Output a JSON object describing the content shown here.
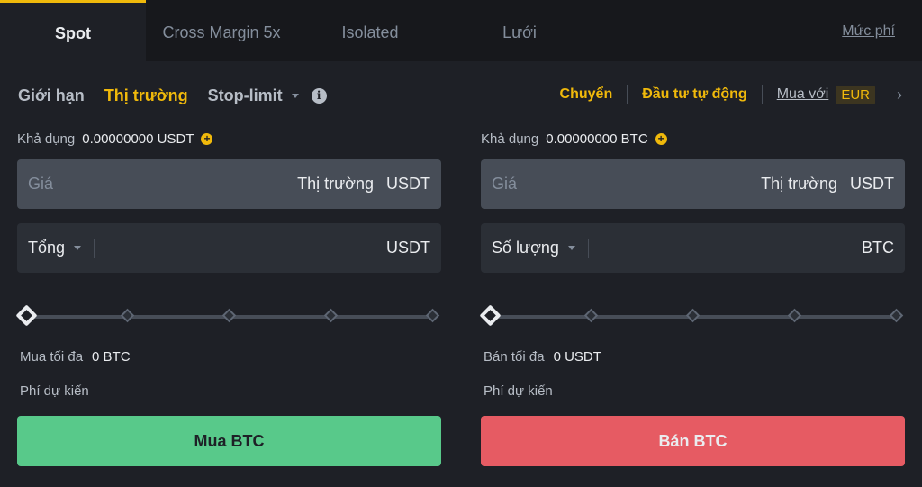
{
  "tabs": [
    {
      "label": "Spot"
    },
    {
      "label": "Cross Margin 5x"
    },
    {
      "label": "Isolated"
    },
    {
      "label": "Lưới"
    }
  ],
  "fee_link": "Mức phí",
  "order_types": {
    "limit": "Giới hạn",
    "market": "Thị trường",
    "stop_limit": "Stop-limit"
  },
  "right_links": {
    "transfer": "Chuyển",
    "auto_invest": "Đầu tư tự động",
    "buy_with": "Mua với",
    "currency": "EUR"
  },
  "buy": {
    "avail_label": "Khả dụng",
    "avail_value": "0.00000000 USDT",
    "price_placeholder": "Giá",
    "price_value": "Thị trường",
    "price_unit": "USDT",
    "amount_selector": "Tổng",
    "amount_unit": "USDT",
    "slider_percent": 0,
    "max_label": "Mua tối đa",
    "max_value": "0 BTC",
    "fee_label": "Phí dự kiến",
    "button": "Mua BTC"
  },
  "sell": {
    "avail_label": "Khả dụng",
    "avail_value": "0.00000000 BTC",
    "price_placeholder": "Giá",
    "price_value": "Thị trường",
    "price_unit": "USDT",
    "amount_selector": "Số lượng",
    "amount_unit": "BTC",
    "slider_percent": 0,
    "max_label": "Bán tối đa",
    "max_value": "0 USDT",
    "fee_label": "Phí dự kiến",
    "button": "Bán BTC"
  },
  "colors": {
    "accent": "#f0b90b",
    "buy": "#58c98a",
    "sell": "#e65b63",
    "background": "#1e2026"
  }
}
